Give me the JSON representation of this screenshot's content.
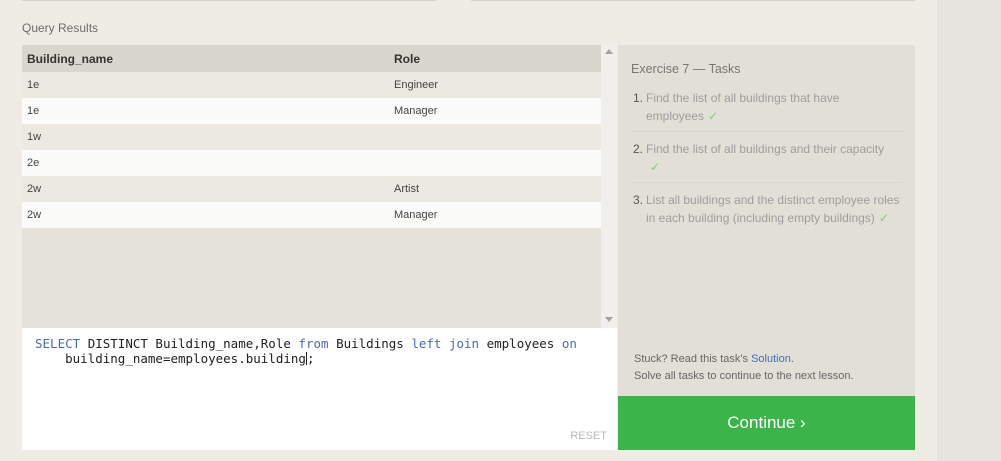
{
  "section_label": "Query Results",
  "results": {
    "columns": [
      "Building_name",
      "Role"
    ],
    "rows": [
      [
        "1e",
        "Engineer"
      ],
      [
        "1e",
        "Manager"
      ],
      [
        "1w",
        ""
      ],
      [
        "2e",
        ""
      ],
      [
        "2w",
        "Artist"
      ],
      [
        "2w",
        "Manager"
      ]
    ]
  },
  "editor": {
    "tokens": [
      "SELECT",
      "DISTINCT Building_name,Role",
      "from",
      "Buildings",
      "left join",
      "employees",
      "on",
      "building_name=employees.building",
      ";"
    ],
    "reset_label": "RESET"
  },
  "tasks_panel": {
    "title": "Exercise 7 — Tasks",
    "items": [
      {
        "num": "1.",
        "text": "Find the list of all buildings that have employees",
        "check": "✓"
      },
      {
        "num": "2.",
        "text": "Find the list of all buildings and their capacity",
        "check": "✓"
      },
      {
        "num": "3.",
        "text": "List all buildings and the distinct employee roles in each building (including empty buildings)",
        "check": "✓"
      }
    ],
    "stuck_prefix": "Stuck? Read this task's",
    "solution_link": "Solution",
    "stuck_suffix": ".",
    "solve_note": "Solve all tasks to continue to the next lesson."
  },
  "continue_label": "Continue ›",
  "colors": {
    "accent_green": "#3bb54a",
    "keyword_blue": "#4a6bb0",
    "link_blue": "#3c6fc7",
    "check_green": "#7fce73"
  }
}
